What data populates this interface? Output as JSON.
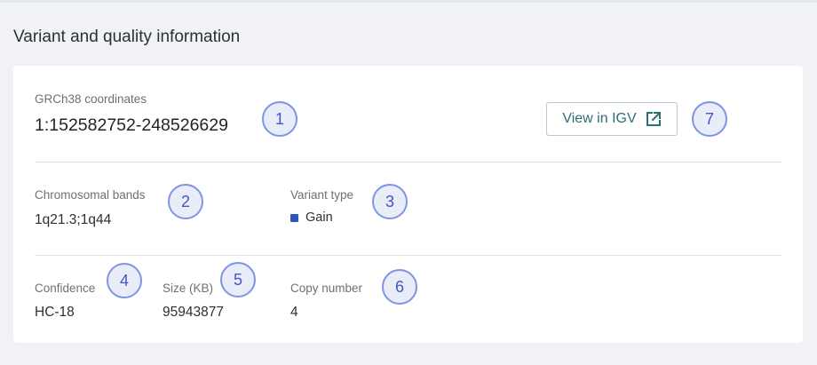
{
  "section": {
    "title": "Variant and quality information"
  },
  "coordinates": {
    "label": "GRCh38 coordinates",
    "value": "1:152582752-248526629"
  },
  "igv_button": {
    "label": "View in IGV",
    "icon": "external-link-icon"
  },
  "chromosomal_bands": {
    "label": "Chromosomal bands",
    "value": "1q21.3;1q44"
  },
  "variant_type": {
    "label": "Variant type",
    "value": "Gain",
    "swatch_color": "#2b59b8"
  },
  "confidence": {
    "label": "Confidence",
    "value": "HC-18"
  },
  "size": {
    "label": "Size (KB)",
    "value": "95943877"
  },
  "copy_number": {
    "label": "Copy number",
    "value": "4"
  },
  "markers": [
    "1",
    "2",
    "3",
    "4",
    "5",
    "6",
    "7"
  ],
  "colors": {
    "accent": "#2a6f77",
    "marker_border": "#7f94e6",
    "marker_text": "#4356c9"
  }
}
